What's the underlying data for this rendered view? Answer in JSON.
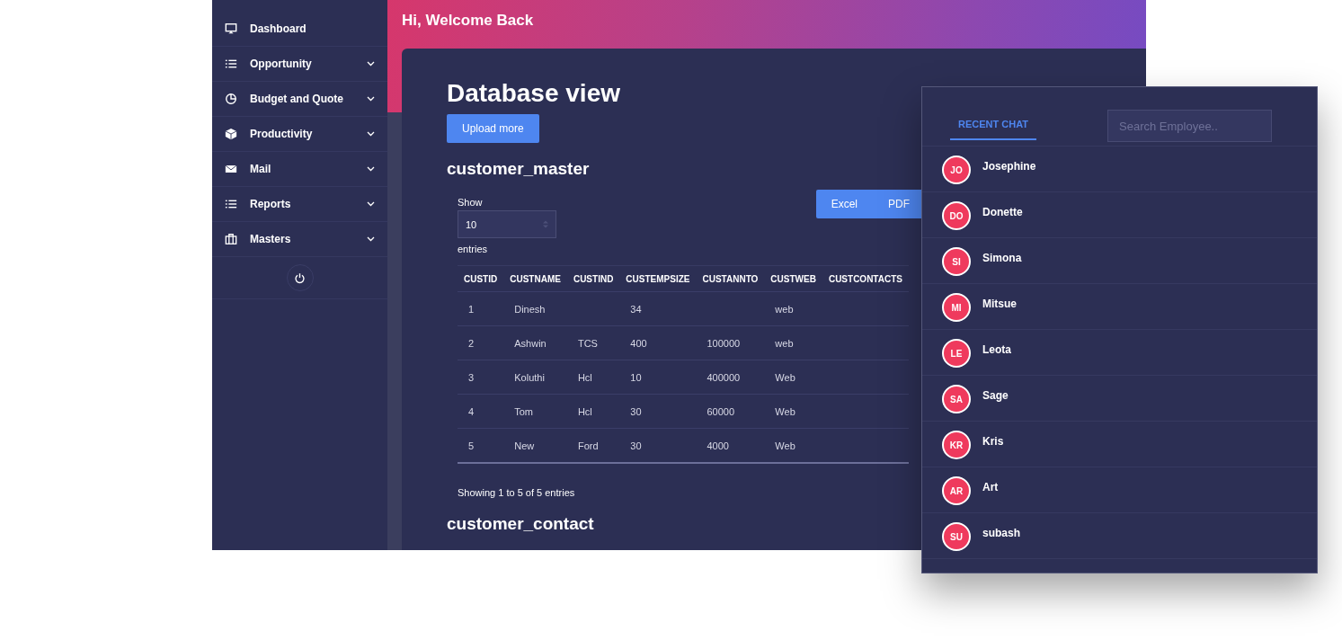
{
  "sidebar": {
    "items": [
      {
        "label": "Dashboard",
        "kind": "monitor",
        "expandable": false
      },
      {
        "label": "Opportunity",
        "kind": "list",
        "expandable": true
      },
      {
        "label": "Budget and Quote",
        "kind": "pie",
        "expandable": true
      },
      {
        "label": "Productivity",
        "kind": "cube",
        "expandable": true
      },
      {
        "label": "Mail",
        "kind": "mail",
        "expandable": true
      },
      {
        "label": "Reports",
        "kind": "list",
        "expandable": true
      },
      {
        "label": "Masters",
        "kind": "briefcase",
        "expandable": true
      }
    ]
  },
  "header": {
    "greeting": "Hi, Welcome Back"
  },
  "page": {
    "title": "Database view",
    "upload_button": "Upload more",
    "sections": [
      {
        "title": "customer_master",
        "show_label": "Show",
        "page_size": "10",
        "entries_label": "entries",
        "export_buttons": [
          "Excel",
          "PDF"
        ],
        "table": {
          "columns": [
            "CUSTID",
            "CUSTNAME",
            "CUSTIND",
            "CUSTEMPSIZE",
            "CUSTANNTO",
            "CUSTWEB",
            "CUSTCONTACTS"
          ],
          "rows": [
            [
              "1",
              "Dinesh",
              "",
              "34",
              "",
              "web",
              ""
            ],
            [
              "2",
              "Ashwin",
              "TCS",
              "400",
              "100000",
              "web",
              ""
            ],
            [
              "3",
              "Koluthi",
              "Hcl",
              "10",
              "400000",
              "Web",
              ""
            ],
            [
              "4",
              "Tom",
              "Hcl",
              "30",
              "60000",
              "Web",
              ""
            ],
            [
              "5",
              "New",
              "Ford",
              "30",
              "4000",
              "Web",
              ""
            ]
          ]
        },
        "info": "Showing 1 to 5 of 5 entries"
      },
      {
        "title": "customer_contact"
      }
    ]
  },
  "chat": {
    "tabs": [
      {
        "label": "RECENT CHAT",
        "selected": true
      }
    ],
    "search": {
      "placeholder": "Search Employee.."
    },
    "contacts": [
      {
        "initials": "JO",
        "name": "Josephine"
      },
      {
        "initials": "DO",
        "name": "Donette"
      },
      {
        "initials": "SI",
        "name": "Simona"
      },
      {
        "initials": "MI",
        "name": "Mitsue"
      },
      {
        "initials": "LE",
        "name": "Leota"
      },
      {
        "initials": "SA",
        "name": "Sage"
      },
      {
        "initials": "KR",
        "name": "Kris"
      },
      {
        "initials": "AR",
        "name": "Art"
      },
      {
        "initials": "SU",
        "name": "subash"
      }
    ]
  }
}
